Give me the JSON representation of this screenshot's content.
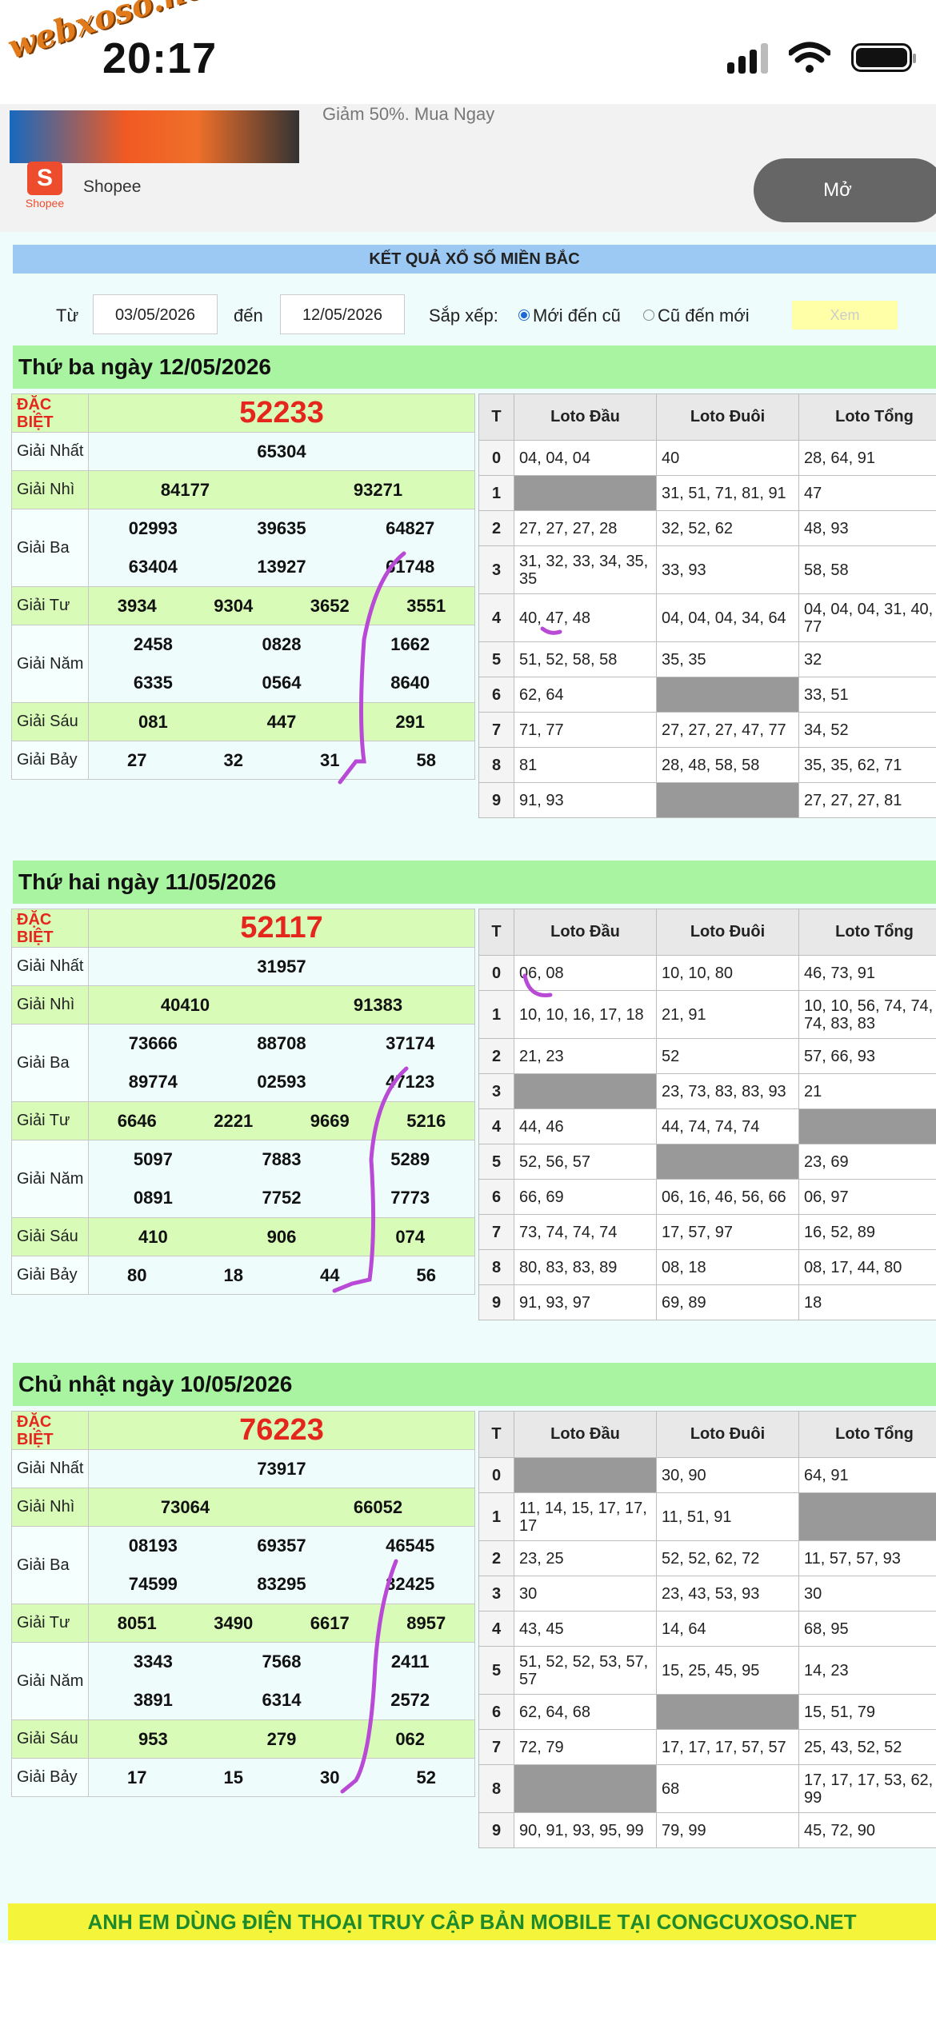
{
  "status_bar": {
    "time": "20:17",
    "watermark": "webxoso.net"
  },
  "ad": {
    "headline": "Giảm 50%. Mua Ngay",
    "logo_text": "S",
    "logo_caption": "Shopee",
    "brand": "Shopee",
    "open_label": "Mở"
  },
  "banner": "KẾT QUẢ XỔ SỐ MIỀN BẮC",
  "filter": {
    "from_label": "Từ",
    "from_value": "03/05/2026",
    "to_label": "đến",
    "to_value": "12/05/2026",
    "sort_label": "Sắp xếp:",
    "option_new": "Mới đến cũ",
    "option_old": "Cũ đến mới",
    "view_label": "Xem"
  },
  "prize_names": {
    "db": "ĐẶC BIỆT",
    "g1": "Giải Nhất",
    "g2": "Giải Nhì",
    "g3": "Giải Ba",
    "g4": "Giải Tư",
    "g5": "Giải Năm",
    "g6": "Giải Sáu",
    "g7": "Giải Bảy"
  },
  "loto_headers": {
    "t": "T",
    "dau": "Loto Đầu",
    "duoi": "Loto Đuôi",
    "tong": "Loto Tổng"
  },
  "days": [
    {
      "title": "Thứ ba ngày 12/05/2026",
      "db": "52233",
      "g1": "65304",
      "g2": [
        "84177",
        "93271"
      ],
      "g3": [
        "02993",
        "39635",
        "64827",
        "63404",
        "13927",
        "61748"
      ],
      "g4": [
        "3934",
        "9304",
        "3652",
        "3551"
      ],
      "g5": [
        "2458",
        "0828",
        "1662",
        "6335",
        "0564",
        "8640"
      ],
      "g6": [
        "081",
        "447",
        "291"
      ],
      "g7": [
        "27",
        "32",
        "31",
        "58"
      ],
      "loto": [
        [
          "0",
          "04, 04, 04",
          "40",
          "28, 64, 91"
        ],
        [
          "1",
          "",
          "31, 51, 71, 81, 91",
          "47"
        ],
        [
          "2",
          "27, 27, 27, 28",
          "32, 52, 62",
          "48, 93"
        ],
        [
          "3",
          "31, 32, 33, 34, 35, 35",
          "33, 93",
          "58, 58"
        ],
        [
          "4",
          "40, 47, 48",
          "04, 04, 04, 34, 64",
          "04, 04, 04, 31, 40, 77"
        ],
        [
          "5",
          "51, 52, 58, 58",
          "35, 35",
          "32"
        ],
        [
          "6",
          "62, 64",
          "",
          "33, 51"
        ],
        [
          "7",
          "71, 77",
          "27, 27, 27, 47, 77",
          "34, 52"
        ],
        [
          "8",
          "81",
          "28, 48, 58, 58",
          "35, 35, 62, 71"
        ],
        [
          "9",
          "91, 93",
          "",
          "27, 27, 27, 81"
        ]
      ]
    },
    {
      "title": "Thứ hai ngày 11/05/2026",
      "db": "52117",
      "g1": "31957",
      "g2": [
        "40410",
        "91383"
      ],
      "g3": [
        "73666",
        "88708",
        "37174",
        "89774",
        "02593",
        "47123"
      ],
      "g4": [
        "6646",
        "2221",
        "9669",
        "5216"
      ],
      "g5": [
        "5097",
        "7883",
        "5289",
        "0891",
        "7752",
        "7773"
      ],
      "g6": [
        "410",
        "906",
        "074"
      ],
      "g7": [
        "80",
        "18",
        "44",
        "56"
      ],
      "loto": [
        [
          "0",
          "06, 08",
          "10, 10, 80",
          "46, 73, 91"
        ],
        [
          "1",
          "10, 10, 16, 17, 18",
          "21, 91",
          "10, 10, 56, 74, 74, 74, 83, 83"
        ],
        [
          "2",
          "21, 23",
          "52",
          "57, 66, 93"
        ],
        [
          "3",
          "",
          "23, 73, 83, 83, 93",
          "21"
        ],
        [
          "4",
          "44, 46",
          "44, 74, 74, 74",
          ""
        ],
        [
          "5",
          "52, 56, 57",
          "",
          "23, 69"
        ],
        [
          "6",
          "66, 69",
          "06, 16, 46, 56, 66",
          "06, 97"
        ],
        [
          "7",
          "73, 74, 74, 74",
          "17, 57, 97",
          "16, 52, 89"
        ],
        [
          "8",
          "80, 83, 83, 89",
          "08, 18",
          "08, 17, 44, 80"
        ],
        [
          "9",
          "91, 93, 97",
          "69, 89",
          "18"
        ]
      ]
    },
    {
      "title": "Chủ nhật ngày 10/05/2026",
      "db": "76223",
      "g1": "73917",
      "g2": [
        "73064",
        "66052"
      ],
      "g3": [
        "08193",
        "69357",
        "46545",
        "74599",
        "83295",
        "32425"
      ],
      "g4": [
        "8051",
        "3490",
        "6617",
        "8957"
      ],
      "g5": [
        "3343",
        "7568",
        "2411",
        "3891",
        "6314",
        "2572"
      ],
      "g6": [
        "953",
        "279",
        "062"
      ],
      "g7": [
        "17",
        "15",
        "30",
        "52"
      ],
      "loto": [
        [
          "0",
          "",
          "30, 90",
          "64, 91"
        ],
        [
          "1",
          "11, 14, 15, 17, 17, 17",
          "11, 51, 91",
          ""
        ],
        [
          "2",
          "23, 25",
          "52, 52, 62, 72",
          "11, 57, 57, 93"
        ],
        [
          "3",
          "30",
          "23, 43, 53, 93",
          "30"
        ],
        [
          "4",
          "43, 45",
          "14, 64",
          "68, 95"
        ],
        [
          "5",
          "51, 52, 52, 53, 57, 57",
          "15, 25, 45, 95",
          "14, 23"
        ],
        [
          "6",
          "62, 64, 68",
          "",
          "15, 51, 79"
        ],
        [
          "7",
          "72, 79",
          "17, 17, 17, 57, 57",
          "25, 43, 52, 52"
        ],
        [
          "8",
          "",
          "68",
          "17, 17, 17, 53, 62, 99"
        ],
        [
          "9",
          "90, 91, 93, 95, 99",
          "79, 99",
          "45, 72, 90"
        ]
      ]
    }
  ],
  "footer": "ANH EM DÙNG ĐIỆN THOẠI TRUY CẬP BẢN MOBILE TẠI CONGCUXOSO.NET"
}
